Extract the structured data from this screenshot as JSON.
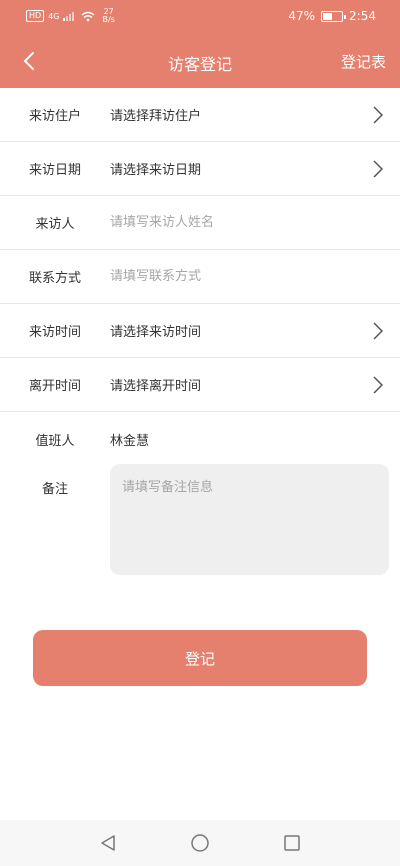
{
  "status": {
    "hd": "HD",
    "net": "4G",
    "speed_value": "27",
    "speed_unit": "B/s",
    "battery": "47%",
    "battery_level": 0.47,
    "time": "2:54"
  },
  "header": {
    "title": "访客登记",
    "right_link": "登记表"
  },
  "form": {
    "rows": [
      {
        "label": "来访住户",
        "value": "请选择拜访住户"
      },
      {
        "label": "来访日期",
        "value": "请选择来访日期"
      },
      {
        "label": "来访人",
        "placeholder": "请填写来访人姓名"
      },
      {
        "label": "联系方式",
        "placeholder": "请填写联系方式"
      },
      {
        "label": "来访时间",
        "value": "请选择来访时间"
      },
      {
        "label": "离开时间",
        "value": "请选择离开时间"
      }
    ],
    "duty": {
      "label": "值班人",
      "value": "林金慧"
    },
    "remark": {
      "label": "备注",
      "placeholder": "请填写备注信息"
    }
  },
  "submit_label": "登记",
  "icons": {
    "back": "chevron-left-icon",
    "row_arrow": "chevron-right-icon",
    "nav_back": "triangle-back-icon",
    "nav_home": "circle-home-icon",
    "nav_recent": "square-recent-icon"
  },
  "colors": {
    "accent": "#e5806f",
    "remark_bg": "#efefef"
  }
}
